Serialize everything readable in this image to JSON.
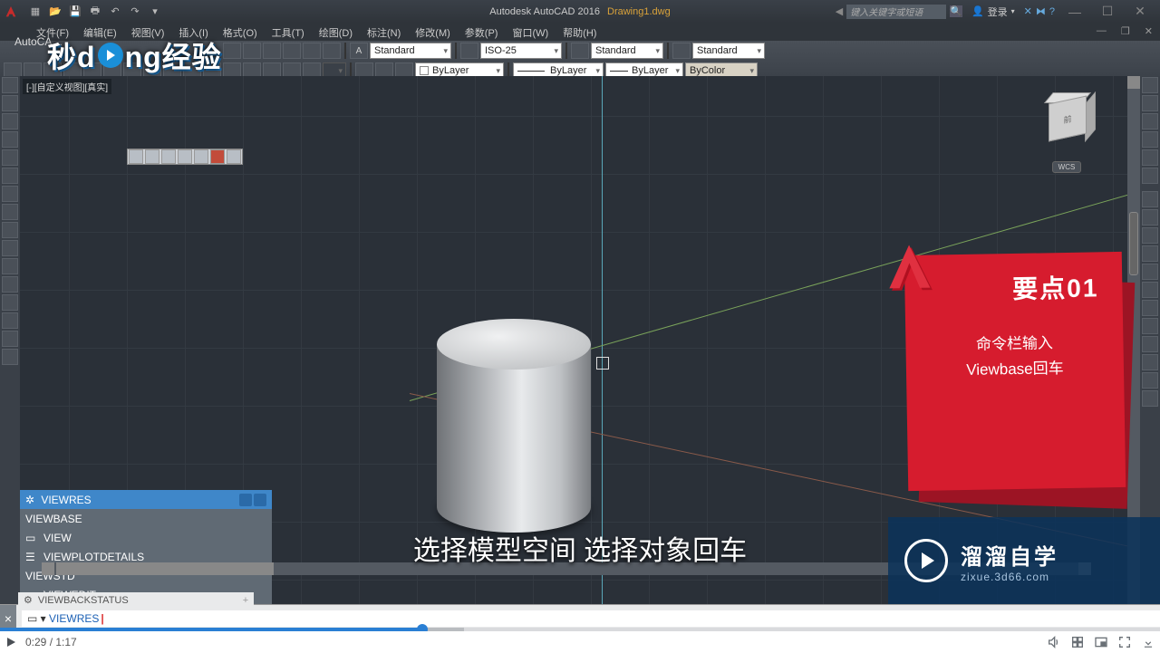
{
  "titlebar": {
    "app": "Autodesk AutoCAD 2016",
    "doc": "Drawing1.dwg",
    "search_placeholder": "键入关键字或短语",
    "login": "登录"
  },
  "menus": [
    "文件(F)",
    "编辑(E)",
    "视图(V)",
    "插入(I)",
    "格式(O)",
    "工具(T)",
    "绘图(D)",
    "标注(N)",
    "修改(M)",
    "参数(P)",
    "窗口(W)",
    "帮助(H)"
  ],
  "brand": "AutoCA…",
  "row1": {
    "style1": "Standard",
    "style2": "ISO-25",
    "style3": "Standard",
    "style4": "Standard"
  },
  "row2": {
    "layer": "ByLayer",
    "ltype": "ByLayer",
    "lweight": "ByLayer",
    "color": "ByColor"
  },
  "viewport_label": "[-][自定义视图][真实]",
  "viewcube": {
    "face": "前",
    "wcs": "WCS"
  },
  "autocomplete": {
    "header": "VIEWRES",
    "items": [
      "VIEWBASE",
      "VIEW",
      "VIEWPLOTDETAILS",
      "VIEWSTD",
      "VIEWEDIT"
    ]
  },
  "cmd_status": "VIEWBACKSTATUS",
  "cmd_typed": "VIEWRES",
  "tip": {
    "title": "要点01",
    "line1": "命令栏输入",
    "line2": "Viewbase回车"
  },
  "subtitle": "选择模型空间 选择对象回车",
  "wm_top": {
    "a": "秒d",
    "b": "ng经验"
  },
  "wm_br": {
    "t1": "溜溜自学",
    "t2": "zixue.3d66.com"
  },
  "player": {
    "cur": "0:29",
    "dur": "1:17"
  }
}
